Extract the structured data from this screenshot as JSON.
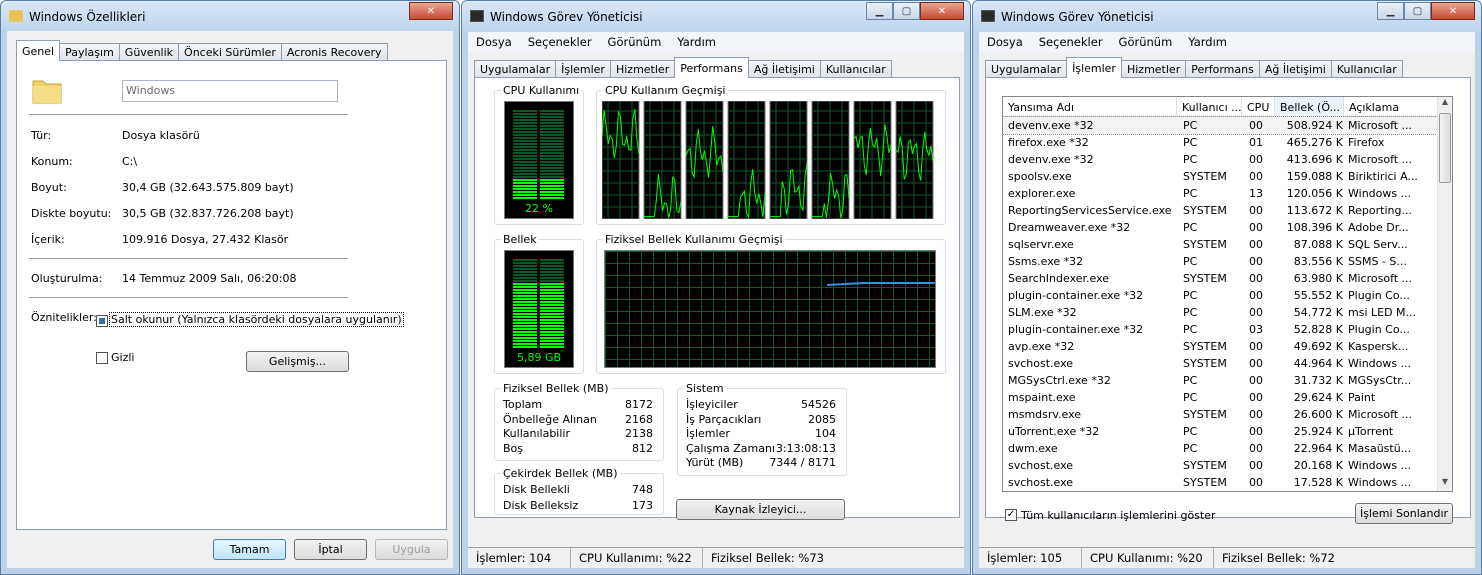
{
  "props": {
    "title": "Windows Özellikleri",
    "tabs": [
      "Genel",
      "Paylaşım",
      "Güvenlik",
      "Önceki Sürümler",
      "Acronis Recovery"
    ],
    "name_value": "Windows",
    "rows": [
      {
        "label": "Tür:",
        "value": "Dosya klasörü"
      },
      {
        "label": "Konum:",
        "value": "C:\\"
      },
      {
        "label": "Boyut:",
        "value": "30,4 GB (32.643.575.809 bayt)"
      },
      {
        "label": "Diskte boyutu:",
        "value": "30,5 GB (32.837.726.208 bayt)"
      },
      {
        "label": "İçerik:",
        "value": "109.916 Dosya, 27.432 Klasör"
      },
      {
        "label": "Oluşturulma:",
        "value": "14 Temmuz 2009 Salı, 06:20:08"
      }
    ],
    "attrs_label": "Öznitelikler:",
    "readonly_label": "Salt okunur (Yalnızca klasördeki dosyalara uygulanır)",
    "hidden_label": "Gizli",
    "advanced_label": "Gelişmiş...",
    "ok_label": "Tamam",
    "cancel_label": "İptal",
    "apply_label": "Uygula"
  },
  "tm1": {
    "title": "Windows Görev Yöneticisi",
    "menu": [
      "Dosya",
      "Seçenekler",
      "Görünüm",
      "Yardım"
    ],
    "tabs": [
      "Uygulamalar",
      "İşlemler",
      "Hizmetler",
      "Performans",
      "Ağ İletişimi",
      "Kullanıcılar"
    ],
    "cpu_title": "CPU Kullanımı",
    "cpu_value": "22 %",
    "cpu_percent": 22,
    "cpu_history_title": "CPU Kullanım Geçmişi",
    "mem_title": "Bellek",
    "mem_value": "5,89 GB",
    "mem_fraction": 0.73,
    "mem_history_title": "Fiziksel Bellek Kullanımı Geçmişi",
    "phys": {
      "title": "Fiziksel Bellek (MB)",
      "rows": [
        {
          "k": "Toplam",
          "v": "8172"
        },
        {
          "k": "Önbelleğe Alınan",
          "v": "2168"
        },
        {
          "k": "Kullanılabilir",
          "v": "2138"
        },
        {
          "k": "Boş",
          "v": "812"
        }
      ]
    },
    "kernel": {
      "title": "Çekirdek Bellek (MB)",
      "rows": [
        {
          "k": "Disk Bellekli",
          "v": "748"
        },
        {
          "k": "Disk Belleksiz",
          "v": "173"
        }
      ]
    },
    "system": {
      "title": "Sistem",
      "rows": [
        {
          "k": "İşleyiciler",
          "v": "54526"
        },
        {
          "k": "İş Parçacıkları",
          "v": "2085"
        },
        {
          "k": "İşlemler",
          "v": "104"
        },
        {
          "k": "Çalışma Zamanı",
          "v": "3:13:08:13"
        },
        {
          "k": "Yürüt (MB)",
          "v": "7344 / 8171"
        }
      ]
    },
    "resmon_label": "Kaynak İzleyici...",
    "status": [
      "İşlemler: 104",
      "CPU Kullanımı: %22",
      "Fiziksel Bellek: %73"
    ]
  },
  "tm2": {
    "title": "Windows Görev Yöneticisi",
    "menu": [
      "Dosya",
      "Seçenekler",
      "Görünüm",
      "Yardım"
    ],
    "tabs": [
      "Uygulamalar",
      "İşlemler",
      "Hizmetler",
      "Performans",
      "Ağ İletişimi",
      "Kullanıcılar"
    ],
    "columns": [
      "Yansıma Adı",
      "Kullanıcı ...",
      "CPU",
      "Bellek (Ö...",
      "Açıklama"
    ],
    "rows": [
      [
        "devenv.exe *32",
        "PC",
        "00",
        "508.924 K",
        "Microsoft ..."
      ],
      [
        "firefox.exe *32",
        "PC",
        "01",
        "465.276 K",
        "Firefox"
      ],
      [
        "devenv.exe *32",
        "PC",
        "00",
        "413.696 K",
        "Microsoft ..."
      ],
      [
        "spoolsv.exe",
        "SYSTEM",
        "00",
        "159.088 K",
        "Biriktirici A..."
      ],
      [
        "explorer.exe",
        "PC",
        "13",
        "120.056 K",
        "Windows ..."
      ],
      [
        "ReportingServicesService.exe",
        "SYSTEM",
        "00",
        "113.672 K",
        "Reporting..."
      ],
      [
        "Dreamweaver.exe *32",
        "PC",
        "00",
        "108.396 K",
        "Adobe Dr..."
      ],
      [
        "sqlservr.exe",
        "SYSTEM",
        "00",
        "87.088 K",
        "SQL Serv..."
      ],
      [
        "Ssms.exe *32",
        "PC",
        "00",
        "83.556 K",
        "SSMS - S..."
      ],
      [
        "SearchIndexer.exe",
        "SYSTEM",
        "00",
        "63.980 K",
        "Microsoft ..."
      ],
      [
        "plugin-container.exe *32",
        "PC",
        "00",
        "55.552 K",
        "Plugin Co..."
      ],
      [
        "SLM.exe *32",
        "PC",
        "00",
        "54.772 K",
        "msi LED M..."
      ],
      [
        "plugin-container.exe *32",
        "PC",
        "03",
        "52.828 K",
        "Plugin Co..."
      ],
      [
        "avp.exe *32",
        "SYSTEM",
        "00",
        "49.692 K",
        "Kaspersk..."
      ],
      [
        "svchost.exe",
        "SYSTEM",
        "00",
        "44.964 K",
        "Windows ..."
      ],
      [
        "MGSysCtrl.exe *32",
        "PC",
        "00",
        "31.732 K",
        "MGSysCtr..."
      ],
      [
        "mspaint.exe",
        "PC",
        "00",
        "29.624 K",
        "Paint"
      ],
      [
        "msmdsrv.exe",
        "SYSTEM",
        "00",
        "26.600 K",
        "Microsoft ..."
      ],
      [
        "uTorrent.exe *32",
        "PC",
        "00",
        "25.924 K",
        "µTorrent"
      ],
      [
        "dwm.exe",
        "PC",
        "00",
        "22.964 K",
        "Masaüstü..."
      ],
      [
        "svchost.exe",
        "SYSTEM",
        "00",
        "20.168 K",
        "Windows ..."
      ],
      [
        "svchost.exe",
        "SYSTEM",
        "00",
        "17.528 K",
        "Windows ..."
      ]
    ],
    "show_all_label": "Tüm kullanıcıların işlemlerini göster",
    "end_process_label": "İşlemi Sonlandır",
    "status": [
      "İşlemler: 105",
      "CPU Kullanımı: %20",
      "Fiziksel Bellek: %72"
    ]
  },
  "colors": {
    "graph_green": "#00ff00",
    "graph_grid": "#0b5c28",
    "mem_line": "#3a8ee6"
  }
}
